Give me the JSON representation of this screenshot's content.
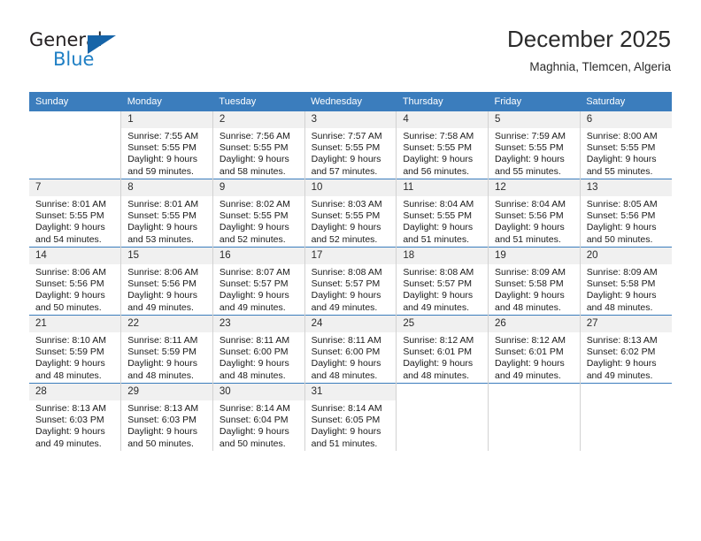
{
  "brand": {
    "name_top": "General",
    "name_bottom": "Blue",
    "logo_icon": "blue-flag-triangle",
    "accent_color": "#1f7fc4"
  },
  "header": {
    "title": "December 2025",
    "subtitle": "Maghnia, Tlemcen, Algeria"
  },
  "calendar": {
    "header_bg": "#3b7dbd",
    "daynum_bg": "#f0f0f0",
    "weekday_headers": [
      "Sunday",
      "Monday",
      "Tuesday",
      "Wednesday",
      "Thursday",
      "Friday",
      "Saturday"
    ],
    "weeks": [
      [
        {
          "day": "",
          "sunrise": "",
          "sunset": "",
          "daylight1": "",
          "daylight2": ""
        },
        {
          "day": "1",
          "sunrise": "Sunrise: 7:55 AM",
          "sunset": "Sunset: 5:55 PM",
          "daylight1": "Daylight: 9 hours",
          "daylight2": "and 59 minutes."
        },
        {
          "day": "2",
          "sunrise": "Sunrise: 7:56 AM",
          "sunset": "Sunset: 5:55 PM",
          "daylight1": "Daylight: 9 hours",
          "daylight2": "and 58 minutes."
        },
        {
          "day": "3",
          "sunrise": "Sunrise: 7:57 AM",
          "sunset": "Sunset: 5:55 PM",
          "daylight1": "Daylight: 9 hours",
          "daylight2": "and 57 minutes."
        },
        {
          "day": "4",
          "sunrise": "Sunrise: 7:58 AM",
          "sunset": "Sunset: 5:55 PM",
          "daylight1": "Daylight: 9 hours",
          "daylight2": "and 56 minutes."
        },
        {
          "day": "5",
          "sunrise": "Sunrise: 7:59 AM",
          "sunset": "Sunset: 5:55 PM",
          "daylight1": "Daylight: 9 hours",
          "daylight2": "and 55 minutes."
        },
        {
          "day": "6",
          "sunrise": "Sunrise: 8:00 AM",
          "sunset": "Sunset: 5:55 PM",
          "daylight1": "Daylight: 9 hours",
          "daylight2": "and 55 minutes."
        }
      ],
      [
        {
          "day": "7",
          "sunrise": "Sunrise: 8:01 AM",
          "sunset": "Sunset: 5:55 PM",
          "daylight1": "Daylight: 9 hours",
          "daylight2": "and 54 minutes."
        },
        {
          "day": "8",
          "sunrise": "Sunrise: 8:01 AM",
          "sunset": "Sunset: 5:55 PM",
          "daylight1": "Daylight: 9 hours",
          "daylight2": "and 53 minutes."
        },
        {
          "day": "9",
          "sunrise": "Sunrise: 8:02 AM",
          "sunset": "Sunset: 5:55 PM",
          "daylight1": "Daylight: 9 hours",
          "daylight2": "and 52 minutes."
        },
        {
          "day": "10",
          "sunrise": "Sunrise: 8:03 AM",
          "sunset": "Sunset: 5:55 PM",
          "daylight1": "Daylight: 9 hours",
          "daylight2": "and 52 minutes."
        },
        {
          "day": "11",
          "sunrise": "Sunrise: 8:04 AM",
          "sunset": "Sunset: 5:55 PM",
          "daylight1": "Daylight: 9 hours",
          "daylight2": "and 51 minutes."
        },
        {
          "day": "12",
          "sunrise": "Sunrise: 8:04 AM",
          "sunset": "Sunset: 5:56 PM",
          "daylight1": "Daylight: 9 hours",
          "daylight2": "and 51 minutes."
        },
        {
          "day": "13",
          "sunrise": "Sunrise: 8:05 AM",
          "sunset": "Sunset: 5:56 PM",
          "daylight1": "Daylight: 9 hours",
          "daylight2": "and 50 minutes."
        }
      ],
      [
        {
          "day": "14",
          "sunrise": "Sunrise: 8:06 AM",
          "sunset": "Sunset: 5:56 PM",
          "daylight1": "Daylight: 9 hours",
          "daylight2": "and 50 minutes."
        },
        {
          "day": "15",
          "sunrise": "Sunrise: 8:06 AM",
          "sunset": "Sunset: 5:56 PM",
          "daylight1": "Daylight: 9 hours",
          "daylight2": "and 49 minutes."
        },
        {
          "day": "16",
          "sunrise": "Sunrise: 8:07 AM",
          "sunset": "Sunset: 5:57 PM",
          "daylight1": "Daylight: 9 hours",
          "daylight2": "and 49 minutes."
        },
        {
          "day": "17",
          "sunrise": "Sunrise: 8:08 AM",
          "sunset": "Sunset: 5:57 PM",
          "daylight1": "Daylight: 9 hours",
          "daylight2": "and 49 minutes."
        },
        {
          "day": "18",
          "sunrise": "Sunrise: 8:08 AM",
          "sunset": "Sunset: 5:57 PM",
          "daylight1": "Daylight: 9 hours",
          "daylight2": "and 49 minutes."
        },
        {
          "day": "19",
          "sunrise": "Sunrise: 8:09 AM",
          "sunset": "Sunset: 5:58 PM",
          "daylight1": "Daylight: 9 hours",
          "daylight2": "and 48 minutes."
        },
        {
          "day": "20",
          "sunrise": "Sunrise: 8:09 AM",
          "sunset": "Sunset: 5:58 PM",
          "daylight1": "Daylight: 9 hours",
          "daylight2": "and 48 minutes."
        }
      ],
      [
        {
          "day": "21",
          "sunrise": "Sunrise: 8:10 AM",
          "sunset": "Sunset: 5:59 PM",
          "daylight1": "Daylight: 9 hours",
          "daylight2": "and 48 minutes."
        },
        {
          "day": "22",
          "sunrise": "Sunrise: 8:11 AM",
          "sunset": "Sunset: 5:59 PM",
          "daylight1": "Daylight: 9 hours",
          "daylight2": "and 48 minutes."
        },
        {
          "day": "23",
          "sunrise": "Sunrise: 8:11 AM",
          "sunset": "Sunset: 6:00 PM",
          "daylight1": "Daylight: 9 hours",
          "daylight2": "and 48 minutes."
        },
        {
          "day": "24",
          "sunrise": "Sunrise: 8:11 AM",
          "sunset": "Sunset: 6:00 PM",
          "daylight1": "Daylight: 9 hours",
          "daylight2": "and 48 minutes."
        },
        {
          "day": "25",
          "sunrise": "Sunrise: 8:12 AM",
          "sunset": "Sunset: 6:01 PM",
          "daylight1": "Daylight: 9 hours",
          "daylight2": "and 48 minutes."
        },
        {
          "day": "26",
          "sunrise": "Sunrise: 8:12 AM",
          "sunset": "Sunset: 6:01 PM",
          "daylight1": "Daylight: 9 hours",
          "daylight2": "and 49 minutes."
        },
        {
          "day": "27",
          "sunrise": "Sunrise: 8:13 AM",
          "sunset": "Sunset: 6:02 PM",
          "daylight1": "Daylight: 9 hours",
          "daylight2": "and 49 minutes."
        }
      ],
      [
        {
          "day": "28",
          "sunrise": "Sunrise: 8:13 AM",
          "sunset": "Sunset: 6:03 PM",
          "daylight1": "Daylight: 9 hours",
          "daylight2": "and 49 minutes."
        },
        {
          "day": "29",
          "sunrise": "Sunrise: 8:13 AM",
          "sunset": "Sunset: 6:03 PM",
          "daylight1": "Daylight: 9 hours",
          "daylight2": "and 50 minutes."
        },
        {
          "day": "30",
          "sunrise": "Sunrise: 8:14 AM",
          "sunset": "Sunset: 6:04 PM",
          "daylight1": "Daylight: 9 hours",
          "daylight2": "and 50 minutes."
        },
        {
          "day": "31",
          "sunrise": "Sunrise: 8:14 AM",
          "sunset": "Sunset: 6:05 PM",
          "daylight1": "Daylight: 9 hours",
          "daylight2": "and 51 minutes."
        },
        {
          "day": "",
          "sunrise": "",
          "sunset": "",
          "daylight1": "",
          "daylight2": ""
        },
        {
          "day": "",
          "sunrise": "",
          "sunset": "",
          "daylight1": "",
          "daylight2": ""
        },
        {
          "day": "",
          "sunrise": "",
          "sunset": "",
          "daylight1": "",
          "daylight2": ""
        }
      ]
    ]
  }
}
